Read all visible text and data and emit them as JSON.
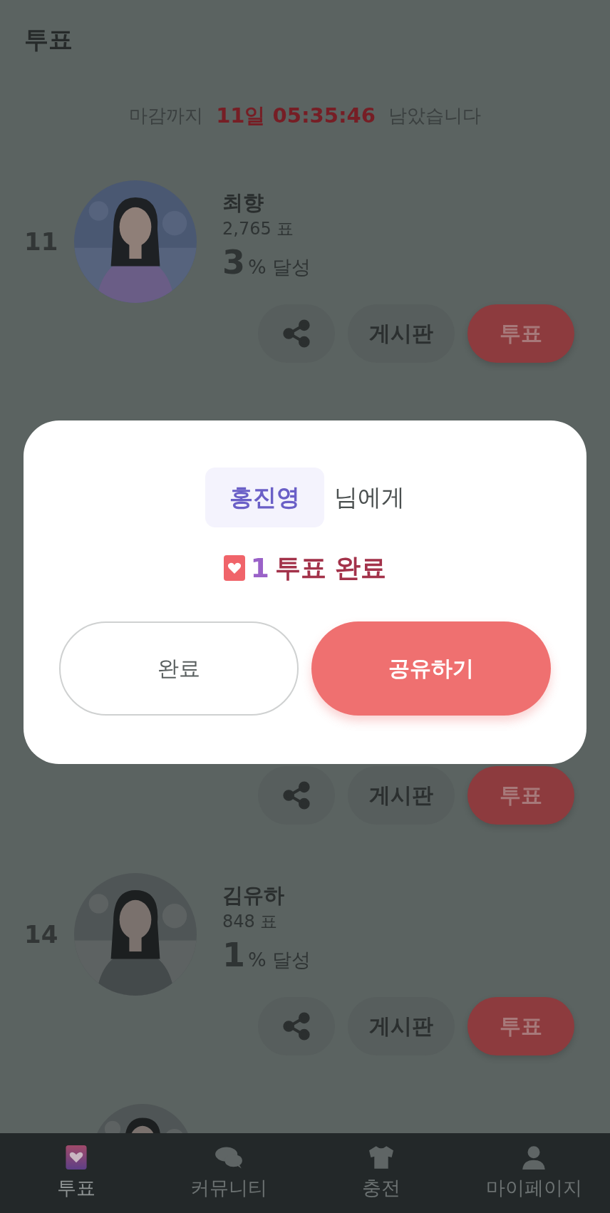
{
  "header": {
    "title": "투표"
  },
  "countdown": {
    "prefix": "마감까지",
    "time": "11일 05:35:46",
    "suffix": "남았습니다"
  },
  "entries": [
    {
      "kind": "full",
      "rank": "11",
      "name": "최향",
      "votes": "2,765 표",
      "percent": "3",
      "percent_label": "% 달성",
      "board_button": "게시판",
      "vote_button": "투표"
    },
    {
      "kind": "actions",
      "board_button": "게시판",
      "vote_button": "투표"
    },
    {
      "kind": "full",
      "rank": "14",
      "name": "김유하",
      "votes": "848 표",
      "percent": "1",
      "percent_label": "% 달성",
      "board_button": "게시판",
      "vote_button": "투표"
    },
    {
      "kind": "picture"
    }
  ],
  "modal": {
    "recipient": "홍진영",
    "recipient_suffix": "님에게",
    "vote_count": "1",
    "result": "투표 완료",
    "buttons": [
      {
        "label": "완료",
        "kind": "secondary"
      },
      {
        "label": "공유하기",
        "kind": "primary"
      }
    ]
  },
  "tab_bar": [
    {
      "label": "투표",
      "kind": "heart",
      "selected": true
    },
    {
      "label": "커뮤니티",
      "kind": "chat",
      "selected": false
    },
    {
      "label": "충전",
      "kind": "shirt",
      "selected": false
    },
    {
      "label": "마이페이지",
      "kind": "person",
      "selected": false
    }
  ]
}
